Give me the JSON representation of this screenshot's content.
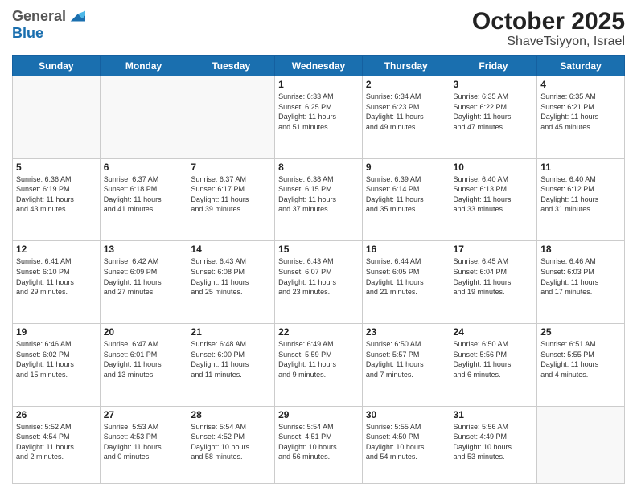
{
  "header": {
    "logo_line1": "General",
    "logo_line2": "Blue",
    "title": "October 2025",
    "subtitle": "ShaveTsiyyon, Israel"
  },
  "weekdays": [
    "Sunday",
    "Monday",
    "Tuesday",
    "Wednesday",
    "Thursday",
    "Friday",
    "Saturday"
  ],
  "weeks": [
    [
      {
        "day": "",
        "info": ""
      },
      {
        "day": "",
        "info": ""
      },
      {
        "day": "",
        "info": ""
      },
      {
        "day": "1",
        "info": "Sunrise: 6:33 AM\nSunset: 6:25 PM\nDaylight: 11 hours\nand 51 minutes."
      },
      {
        "day": "2",
        "info": "Sunrise: 6:34 AM\nSunset: 6:23 PM\nDaylight: 11 hours\nand 49 minutes."
      },
      {
        "day": "3",
        "info": "Sunrise: 6:35 AM\nSunset: 6:22 PM\nDaylight: 11 hours\nand 47 minutes."
      },
      {
        "day": "4",
        "info": "Sunrise: 6:35 AM\nSunset: 6:21 PM\nDaylight: 11 hours\nand 45 minutes."
      }
    ],
    [
      {
        "day": "5",
        "info": "Sunrise: 6:36 AM\nSunset: 6:19 PM\nDaylight: 11 hours\nand 43 minutes."
      },
      {
        "day": "6",
        "info": "Sunrise: 6:37 AM\nSunset: 6:18 PM\nDaylight: 11 hours\nand 41 minutes."
      },
      {
        "day": "7",
        "info": "Sunrise: 6:37 AM\nSunset: 6:17 PM\nDaylight: 11 hours\nand 39 minutes."
      },
      {
        "day": "8",
        "info": "Sunrise: 6:38 AM\nSunset: 6:15 PM\nDaylight: 11 hours\nand 37 minutes."
      },
      {
        "day": "9",
        "info": "Sunrise: 6:39 AM\nSunset: 6:14 PM\nDaylight: 11 hours\nand 35 minutes."
      },
      {
        "day": "10",
        "info": "Sunrise: 6:40 AM\nSunset: 6:13 PM\nDaylight: 11 hours\nand 33 minutes."
      },
      {
        "day": "11",
        "info": "Sunrise: 6:40 AM\nSunset: 6:12 PM\nDaylight: 11 hours\nand 31 minutes."
      }
    ],
    [
      {
        "day": "12",
        "info": "Sunrise: 6:41 AM\nSunset: 6:10 PM\nDaylight: 11 hours\nand 29 minutes."
      },
      {
        "day": "13",
        "info": "Sunrise: 6:42 AM\nSunset: 6:09 PM\nDaylight: 11 hours\nand 27 minutes."
      },
      {
        "day": "14",
        "info": "Sunrise: 6:43 AM\nSunset: 6:08 PM\nDaylight: 11 hours\nand 25 minutes."
      },
      {
        "day": "15",
        "info": "Sunrise: 6:43 AM\nSunset: 6:07 PM\nDaylight: 11 hours\nand 23 minutes."
      },
      {
        "day": "16",
        "info": "Sunrise: 6:44 AM\nSunset: 6:05 PM\nDaylight: 11 hours\nand 21 minutes."
      },
      {
        "day": "17",
        "info": "Sunrise: 6:45 AM\nSunset: 6:04 PM\nDaylight: 11 hours\nand 19 minutes."
      },
      {
        "day": "18",
        "info": "Sunrise: 6:46 AM\nSunset: 6:03 PM\nDaylight: 11 hours\nand 17 minutes."
      }
    ],
    [
      {
        "day": "19",
        "info": "Sunrise: 6:46 AM\nSunset: 6:02 PM\nDaylight: 11 hours\nand 15 minutes."
      },
      {
        "day": "20",
        "info": "Sunrise: 6:47 AM\nSunset: 6:01 PM\nDaylight: 11 hours\nand 13 minutes."
      },
      {
        "day": "21",
        "info": "Sunrise: 6:48 AM\nSunset: 6:00 PM\nDaylight: 11 hours\nand 11 minutes."
      },
      {
        "day": "22",
        "info": "Sunrise: 6:49 AM\nSunset: 5:59 PM\nDaylight: 11 hours\nand 9 minutes."
      },
      {
        "day": "23",
        "info": "Sunrise: 6:50 AM\nSunset: 5:57 PM\nDaylight: 11 hours\nand 7 minutes."
      },
      {
        "day": "24",
        "info": "Sunrise: 6:50 AM\nSunset: 5:56 PM\nDaylight: 11 hours\nand 6 minutes."
      },
      {
        "day": "25",
        "info": "Sunrise: 6:51 AM\nSunset: 5:55 PM\nDaylight: 11 hours\nand 4 minutes."
      }
    ],
    [
      {
        "day": "26",
        "info": "Sunrise: 5:52 AM\nSunset: 4:54 PM\nDaylight: 11 hours\nand 2 minutes."
      },
      {
        "day": "27",
        "info": "Sunrise: 5:53 AM\nSunset: 4:53 PM\nDaylight: 11 hours\nand 0 minutes."
      },
      {
        "day": "28",
        "info": "Sunrise: 5:54 AM\nSunset: 4:52 PM\nDaylight: 10 hours\nand 58 minutes."
      },
      {
        "day": "29",
        "info": "Sunrise: 5:54 AM\nSunset: 4:51 PM\nDaylight: 10 hours\nand 56 minutes."
      },
      {
        "day": "30",
        "info": "Sunrise: 5:55 AM\nSunset: 4:50 PM\nDaylight: 10 hours\nand 54 minutes."
      },
      {
        "day": "31",
        "info": "Sunrise: 5:56 AM\nSunset: 4:49 PM\nDaylight: 10 hours\nand 53 minutes."
      },
      {
        "day": "",
        "info": ""
      }
    ]
  ]
}
